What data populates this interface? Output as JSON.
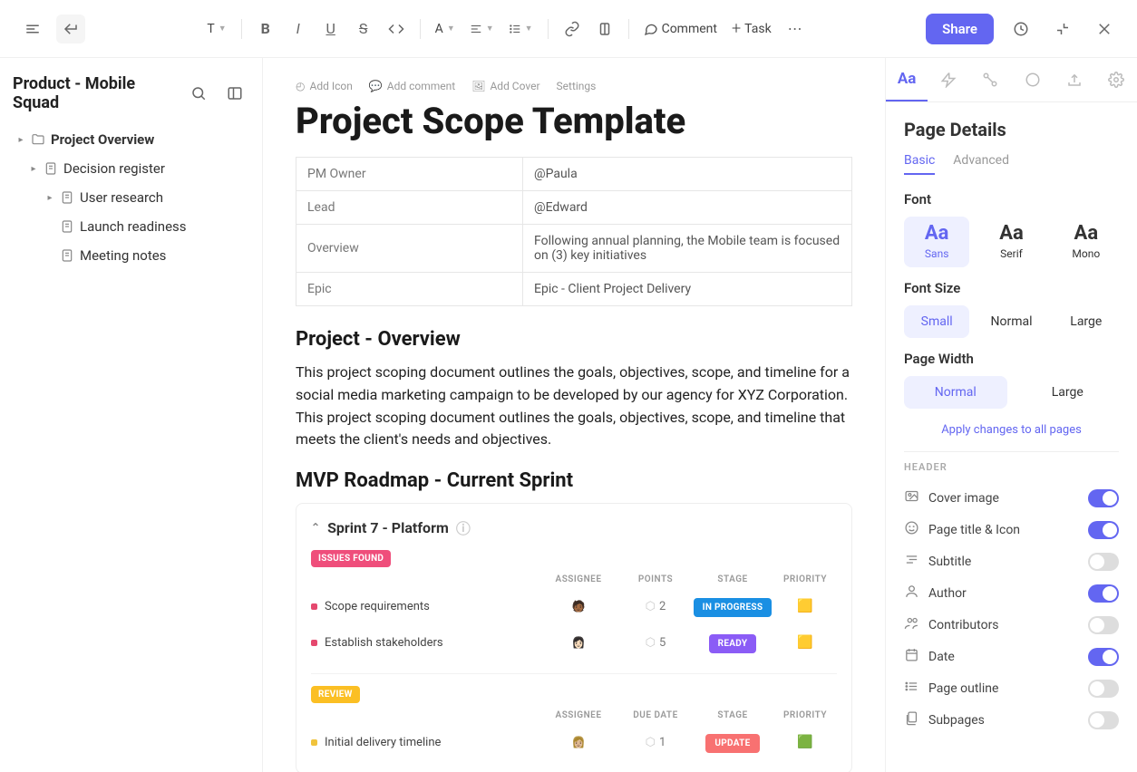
{
  "topbar": {
    "comment_label": "Comment",
    "task_label": "Task",
    "share_label": "Share",
    "text_style_label": "T"
  },
  "sidebar": {
    "title": "Product - Mobile Squad",
    "tree": [
      {
        "label": "Project Overview",
        "level": 0,
        "bold": true,
        "icon": "folder",
        "hasChev": true
      },
      {
        "label": "Decision register",
        "level": 1,
        "icon": "page",
        "hasChev": true
      },
      {
        "label": "User research",
        "level": 2,
        "icon": "page",
        "hasChev": true
      },
      {
        "label": "Launch readiness",
        "level": 2,
        "icon": "page",
        "hasChev": false
      },
      {
        "label": "Meeting notes",
        "level": 2,
        "icon": "page",
        "hasChev": false
      }
    ]
  },
  "doc": {
    "meta": {
      "add_icon": "Add Icon",
      "add_comment": "Add comment",
      "add_cover": "Add Cover",
      "settings": "Settings"
    },
    "title": "Project Scope Template",
    "properties": [
      {
        "key": "PM Owner",
        "value": "@Paula"
      },
      {
        "key": "Lead",
        "value": "@Edward"
      },
      {
        "key": "Overview",
        "value": "Following annual planning, the Mobile team is focused on (3) key initiatives"
      },
      {
        "key": "Epic",
        "value": "Epic - Client Project Delivery"
      }
    ],
    "section1_heading": "Project - Overview",
    "section1_body": "This project scoping document outlines the goals, objectives, scope, and timeline for a social media marketing campaign to be developed by our agency for XYZ Corporation. This project scoping document outlines the goals, objectives, scope, and timeline that meets the client's needs and objectives.",
    "section2_heading": "MVP Roadmap - Current Sprint",
    "sprint": {
      "title": "Sprint  7 - Platform",
      "groups": [
        {
          "badge": "ISSUES FOUND",
          "badgeClass": "badge-red",
          "headers": [
            "",
            "ASSIGNEE",
            "POINTS",
            "STAGE",
            "PRIORITY"
          ],
          "rows": [
            {
              "name": "Scope requirements",
              "bullet": "br-red",
              "avatar": "🧑🏾",
              "points": "2",
              "stage": "IN PROGRESS",
              "stageClass": "stage-blue",
              "flag": "🟨"
            },
            {
              "name": "Establish stakeholders",
              "bullet": "br-red",
              "avatar": "👩🏻",
              "points": "5",
              "stage": "READY",
              "stageClass": "stage-purple",
              "flag": "🟨"
            }
          ]
        },
        {
          "badge": "REVIEW",
          "badgeClass": "badge-yellow",
          "headers": [
            "",
            "ASSIGNEE",
            "DUE DATE",
            "STAGE",
            "PRIORITY"
          ],
          "rows": [
            {
              "name": "Initial delivery timeline",
              "bullet": "br-yellow",
              "avatar": "👩🏼",
              "points": "1",
              "stage": "UPDATE",
              "stageClass": "stage-coral",
              "flag": "🟩"
            }
          ]
        }
      ]
    }
  },
  "panel": {
    "title": "Page Details",
    "subtabs": {
      "basic": "Basic",
      "advanced": "Advanced"
    },
    "font_label": "Font",
    "fonts": [
      {
        "name": "Sans",
        "class": "",
        "sel": true
      },
      {
        "name": "Serif",
        "class": "opt-serif",
        "sel": false
      },
      {
        "name": "Mono",
        "class": "opt-mono",
        "sel": false
      }
    ],
    "fontsize_label": "Font Size",
    "fontsizes": [
      {
        "name": "Small",
        "sel": true
      },
      {
        "name": "Normal",
        "sel": false
      },
      {
        "name": "Large",
        "sel": false
      }
    ],
    "pagewidth_label": "Page Width",
    "pagewidths": [
      {
        "name": "Normal",
        "sel": true
      },
      {
        "name": "Large",
        "sel": false
      }
    ],
    "apply_link": "Apply changes to all pages",
    "header_label": "HEADER",
    "toggles": [
      {
        "label": "Cover image",
        "on": true,
        "icon": "image"
      },
      {
        "label": "Page title & Icon",
        "on": true,
        "icon": "emoji"
      },
      {
        "label": "Subtitle",
        "on": false,
        "icon": "text"
      },
      {
        "label": "Author",
        "on": true,
        "icon": "user"
      },
      {
        "label": "Contributors",
        "on": false,
        "icon": "users"
      },
      {
        "label": "Date",
        "on": true,
        "icon": "calendar"
      },
      {
        "label": "Page outline",
        "on": false,
        "icon": "list"
      },
      {
        "label": "Subpages",
        "on": false,
        "icon": "pages"
      }
    ]
  }
}
